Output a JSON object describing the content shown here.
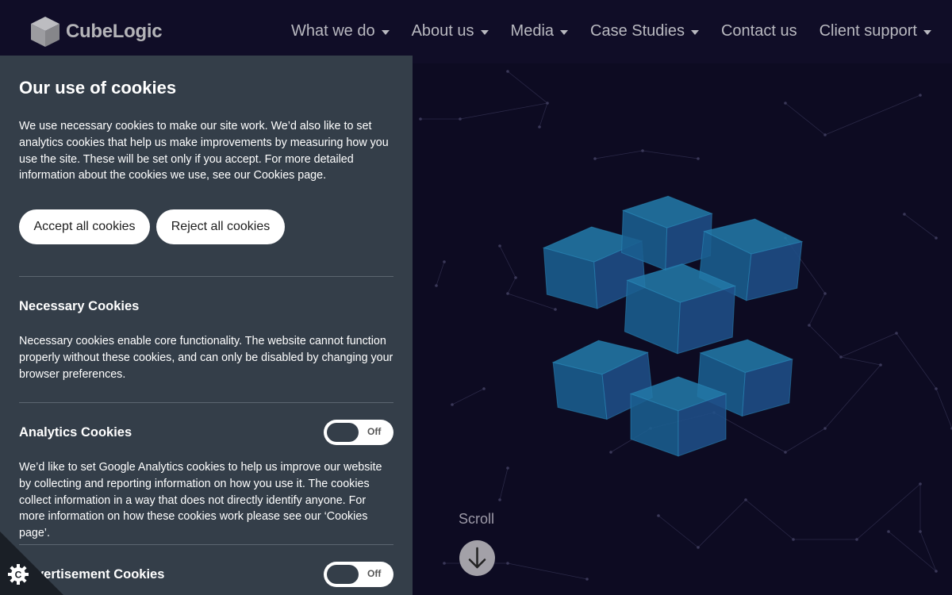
{
  "brand": {
    "name": "CubeLogic",
    "logo_icon": "cube-icon"
  },
  "nav": {
    "items": [
      {
        "label": "What we do",
        "dropdown": true
      },
      {
        "label": "About us",
        "dropdown": true
      },
      {
        "label": "Media",
        "dropdown": true
      },
      {
        "label": "Case Studies",
        "dropdown": true
      },
      {
        "label": "Contact us",
        "dropdown": false
      },
      {
        "label": "Client support",
        "dropdown": true
      }
    ]
  },
  "hero": {
    "scroll_label": "Scroll",
    "scroll_icon": "arrow-down-icon"
  },
  "cookies": {
    "title": "Our use of cookies",
    "intro": "We use necessary cookies to make our site work. We’d also like to set analytics cookies that help us make improvements by measuring how you use the site. These will be set only if you accept. For more detailed information about the cookies we use, see our Cookies page.",
    "accept_label": "Accept all cookies",
    "reject_label": "Reject all cookies",
    "necessary": {
      "title": "Necessary Cookies",
      "text": "Necessary cookies enable core functionality. The website cannot function properly without these cookies, and can only be disabled by changing your browser preferences."
    },
    "analytics": {
      "title": "Analytics Cookies",
      "toggle_state": "Off",
      "text": "We’d like to set Google Analytics cookies to help us improve our website by collecting and reporting information on how you use it. The cookies collect information in a way that does not directly identify anyone. For more information on how these cookies work please see our ‘Cookies page’."
    },
    "advertisement": {
      "title": "Advertisement Cookies",
      "toggle_state": "Off"
    },
    "settings_icon": "cookie-settings-icon"
  },
  "colors": {
    "background": "#0d0b22",
    "panel": "#343e49",
    "cube": "#1a6f9e"
  }
}
